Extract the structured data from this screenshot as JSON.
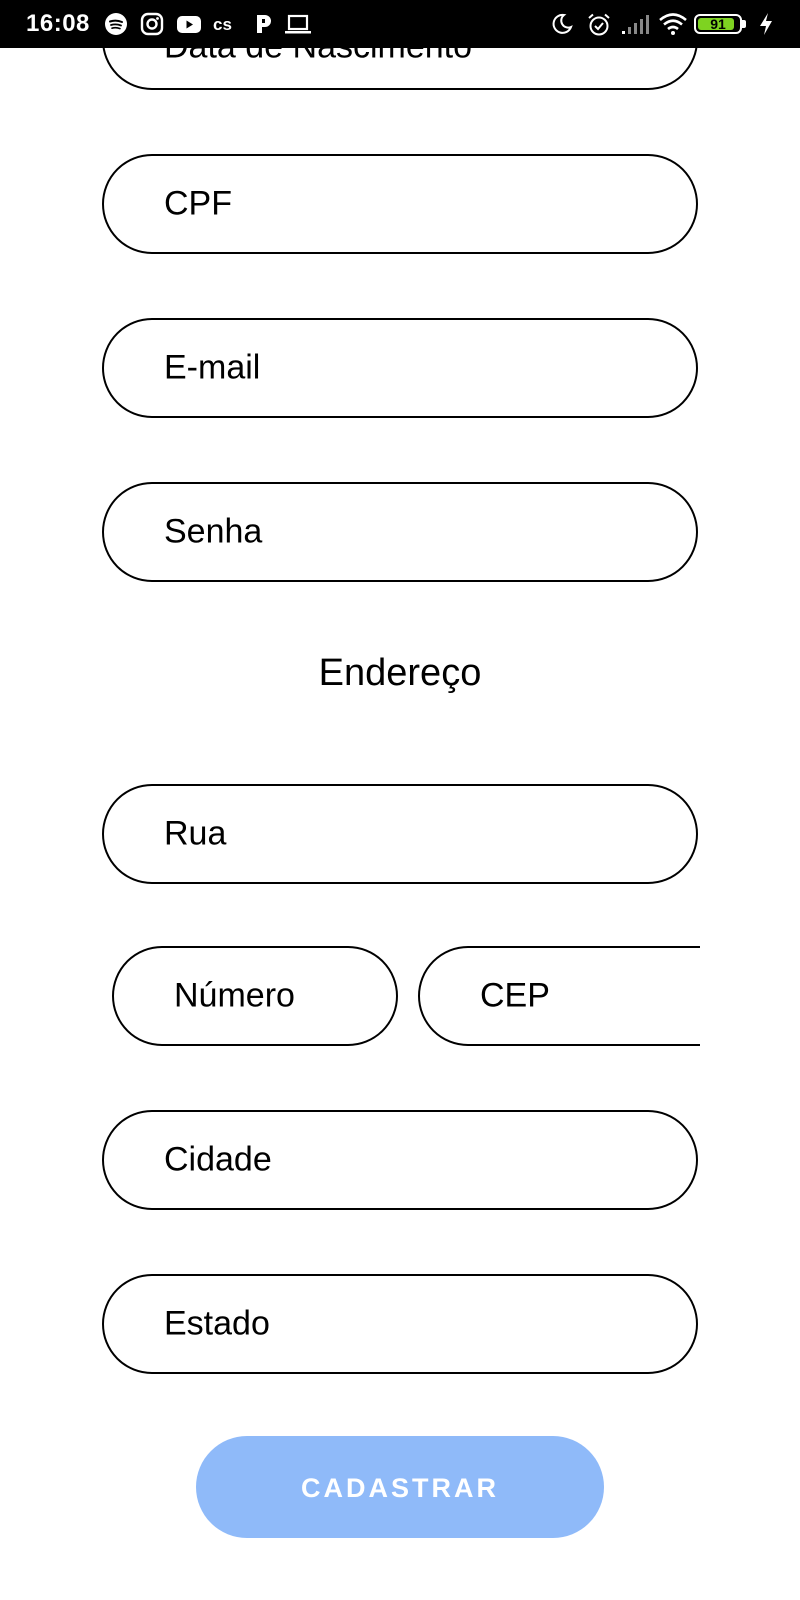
{
  "status_bar": {
    "time": "16:08",
    "battery_level": "91",
    "battery_percent": 91,
    "battery_color": "#7ed321",
    "left_icons": [
      "spotify-icon",
      "instagram-icon",
      "youtube-icon",
      "lastfm-icon",
      "pandora-icon",
      "laptop-icon"
    ],
    "right_icons": [
      "moon-icon",
      "alarm-icon",
      "signal-icon",
      "wifi-icon",
      "battery-icon",
      "charging-icon"
    ]
  },
  "form": {
    "fields": {
      "birthdate": "Data de Nascimento",
      "cpf": "CPF",
      "email": "E-mail",
      "password": "Senha"
    },
    "address_section_title": "Endereço",
    "address_fields": {
      "street": "Rua",
      "number": "Número",
      "zip": "CEP",
      "city": "Cidade",
      "state": "Estado"
    },
    "submit_label": "CADASTRAR",
    "submit_color": "#8fbaf9"
  }
}
